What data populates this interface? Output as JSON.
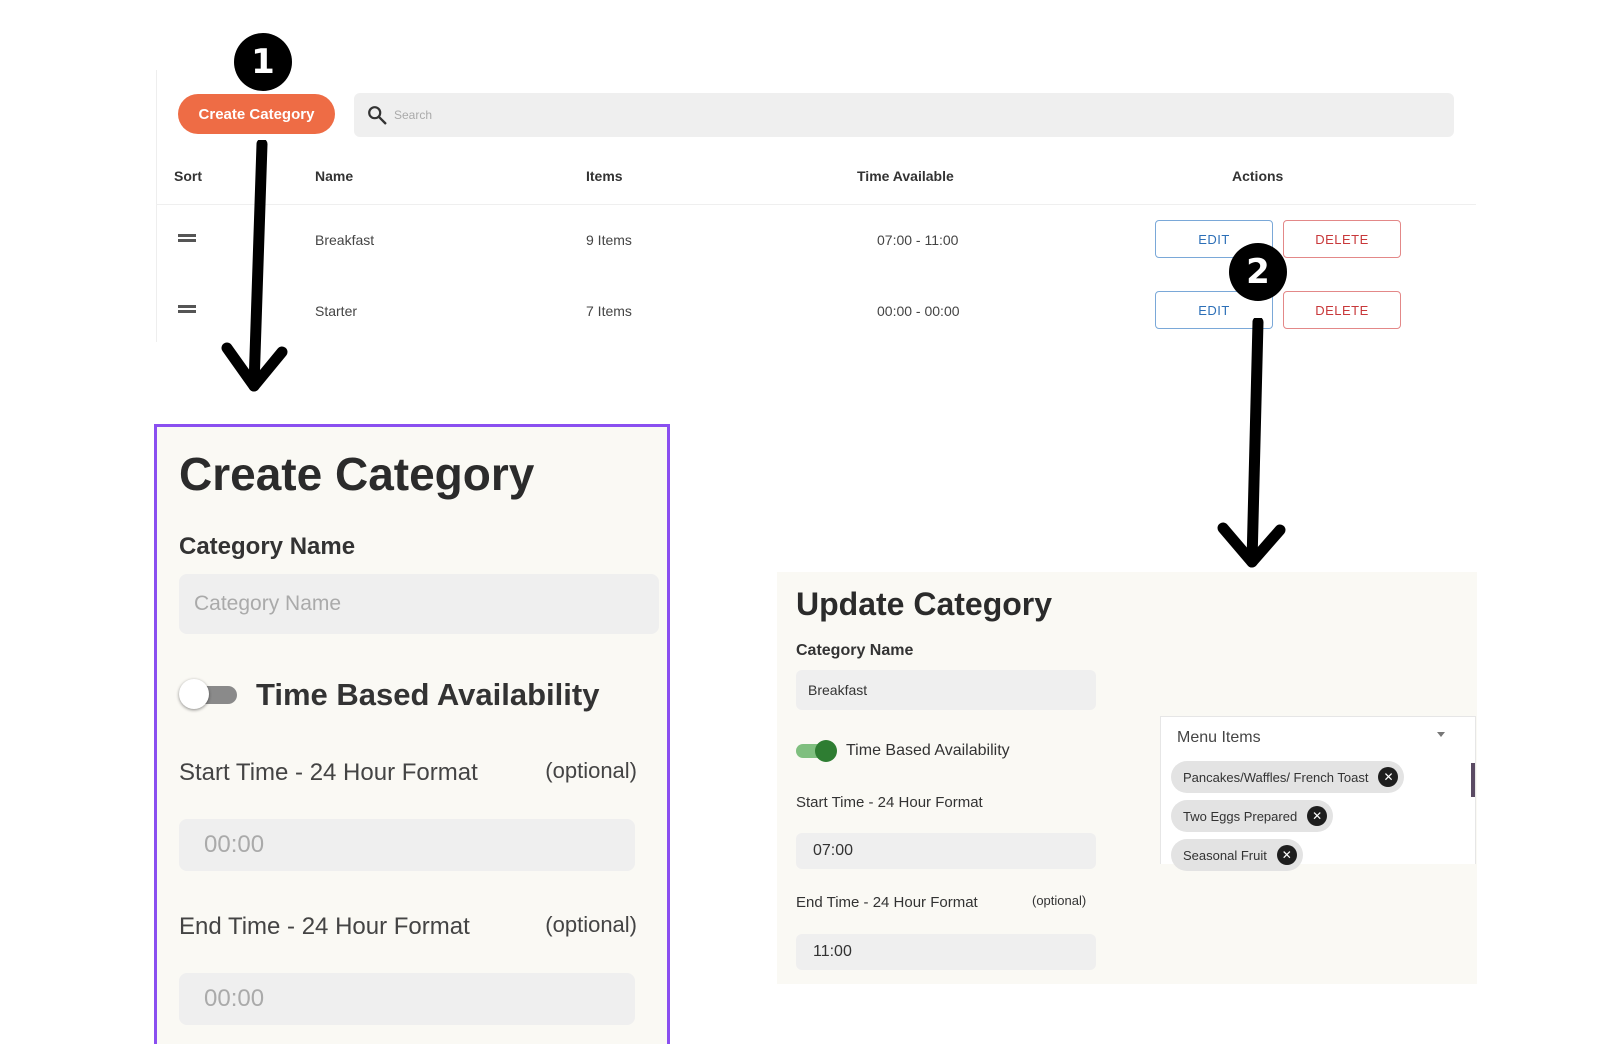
{
  "toolbar": {
    "create_label": "Create Category",
    "search_placeholder": "Search"
  },
  "table": {
    "headers": {
      "sort": "Sort",
      "name": "Name",
      "items": "Items",
      "time": "Time Available",
      "actions": "Actions"
    },
    "rows": [
      {
        "name": "Breakfast",
        "items": "9 Items",
        "time": "07:00 - 11:00",
        "edit": "EDIT",
        "delete": "DELETE"
      },
      {
        "name": "Starter",
        "items": "7 Items",
        "time": "00:00 - 00:00",
        "edit": "EDIT",
        "delete": "DELETE"
      }
    ]
  },
  "steps": {
    "one": "1",
    "two": "2"
  },
  "create_panel": {
    "title": "Create Category",
    "name_label": "Category Name",
    "name_placeholder": "Category Name",
    "toggle_label": "Time Based Availability",
    "toggle_on": false,
    "start_label": "Start Time - 24 Hour Format",
    "start_optional": "(optional)",
    "start_placeholder": "00:00",
    "end_label": "End Time - 24 Hour Format",
    "end_optional": "(optional)",
    "end_placeholder": "00:00"
  },
  "update_panel": {
    "title": "Update Category",
    "name_label": "Category Name",
    "name_value": "Breakfast",
    "toggle_label": "Time Based Availability",
    "toggle_on": true,
    "start_label": "Start Time - 24 Hour Format",
    "start_value": "07:00",
    "end_label": "End Time - 24 Hour Format",
    "end_optional": "(optional)",
    "end_value": "11:00",
    "menu_items_label": "Menu Items",
    "chips": [
      "Pancakes/Waffles/ French Toast",
      "Two Eggs Prepared",
      "Seasonal Fruit"
    ]
  },
  "colors": {
    "accent": "#ee6c45",
    "panel_border": "#8a4ff0",
    "toggle_on": "#2e7d32",
    "edit": "#2c6fb7",
    "delete": "#c8383a"
  },
  "icons": {
    "search": "search-icon",
    "drag": "drag-handle-icon",
    "chip_remove": "close-circle-icon",
    "dropdown": "chevron-down-icon"
  }
}
